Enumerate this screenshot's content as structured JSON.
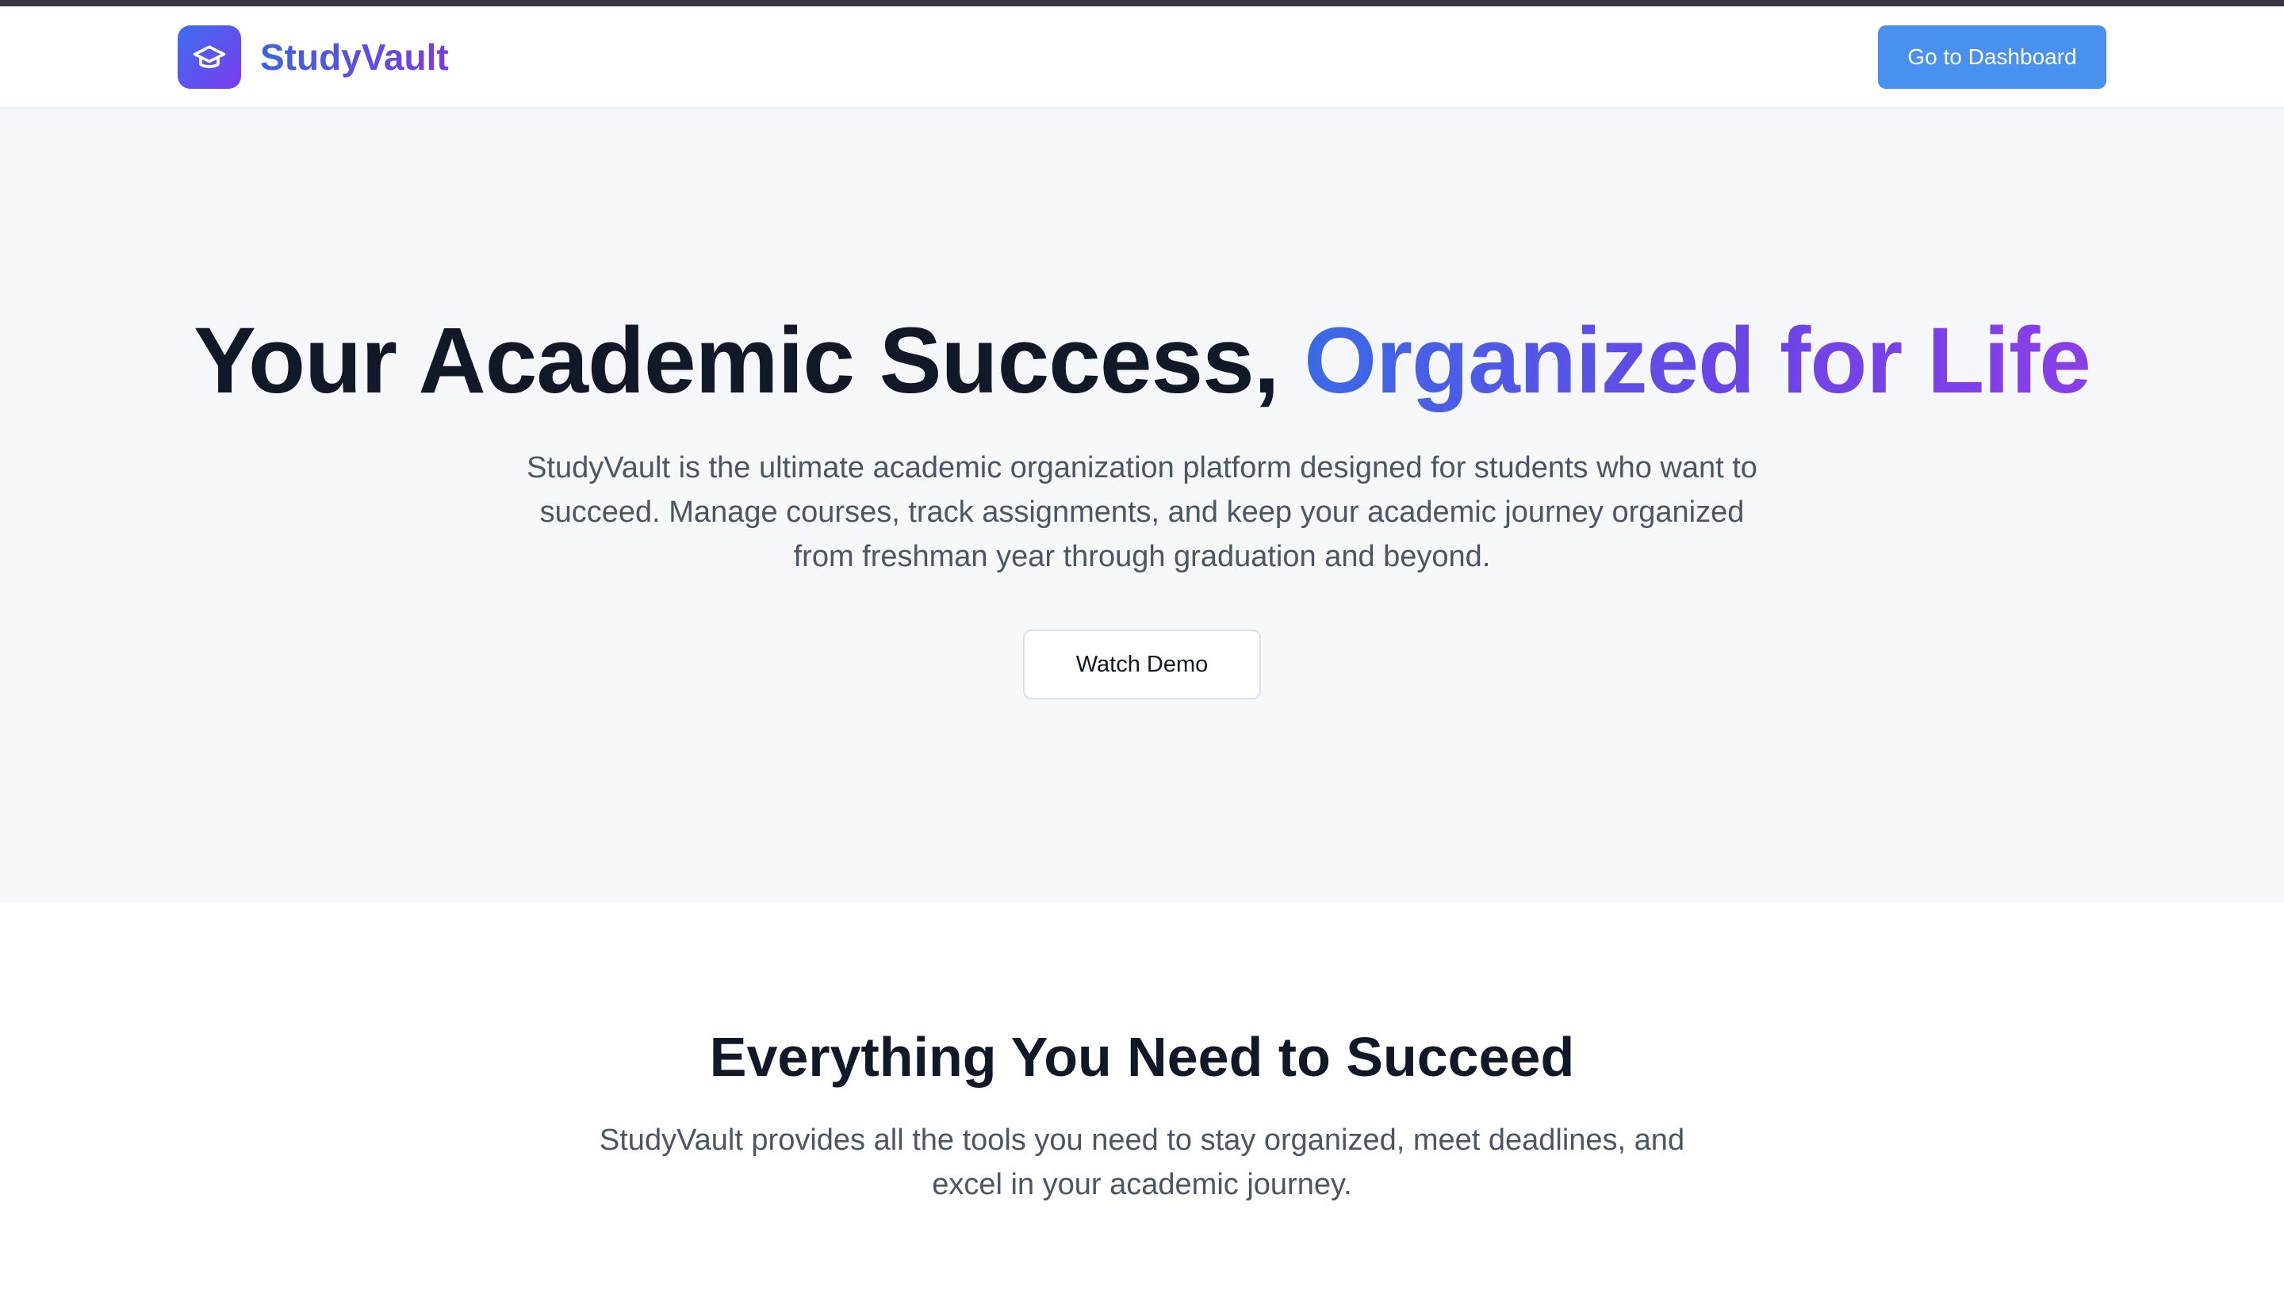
{
  "brand": {
    "name": "StudyVault",
    "icon": "graduation-cap-icon",
    "gradient_from": "#3b6ff0",
    "gradient_to": "#7c3aed"
  },
  "nav": {
    "dashboard_label": "Go to Dashboard",
    "dashboard_color": "#4891ee"
  },
  "hero": {
    "title_plain": "Your Academic Success, ",
    "title_highlight": "Organized for Life",
    "subtitle": "StudyVault is the ultimate academic organization platform designed for students who want to succeed. Manage courses, track assignments, and keep your academic journey organized from freshman year through graduation and beyond.",
    "demo_label": "Watch Demo"
  },
  "features": {
    "title": "Everything You Need to Succeed",
    "subtitle": "StudyVault provides all the tools you need to stay organized, meet deadlines, and excel in your academic journey."
  }
}
